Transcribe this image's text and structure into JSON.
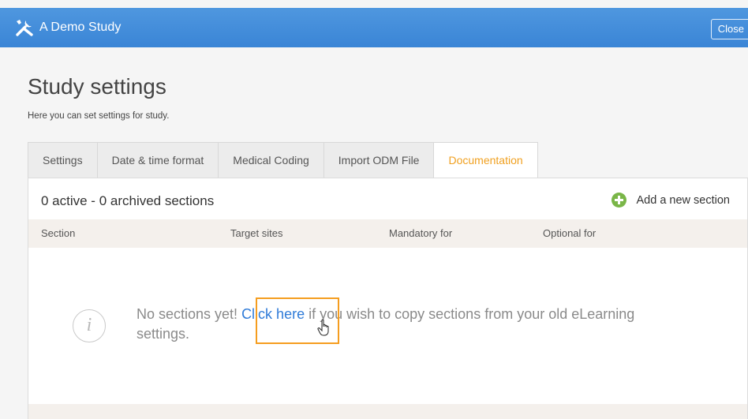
{
  "header": {
    "app_title": "A Demo Study",
    "close_label": "Close",
    "logo_icon": "tools-icon",
    "bar_color": "#3f8bdb"
  },
  "page": {
    "title": "Study settings",
    "subtitle": "Here you can set settings for study."
  },
  "tabs": [
    {
      "label": "Settings",
      "active": false
    },
    {
      "label": "Date & time format",
      "active": false
    },
    {
      "label": "Medical Coding",
      "active": false
    },
    {
      "label": "Import ODM File",
      "active": false
    },
    {
      "label": "Documentation",
      "active": true
    }
  ],
  "documentation": {
    "summary": "0 active - 0 archived sections",
    "add_label": "Add a new section",
    "add_icon": "plus-circle-icon",
    "columns": [
      "Section",
      "Target sites",
      "Mandatory for",
      "Optional for"
    ],
    "empty": {
      "icon": "info-icon",
      "prefix": "No sections yet! ",
      "link": "Click here",
      "suffix": " if you wish to copy sections from your old eLearning settings."
    }
  },
  "colors": {
    "accent": "#f0a020",
    "link": "#2f7bd8",
    "add_green": "#7ab648",
    "highlight": "#f59d1f"
  }
}
